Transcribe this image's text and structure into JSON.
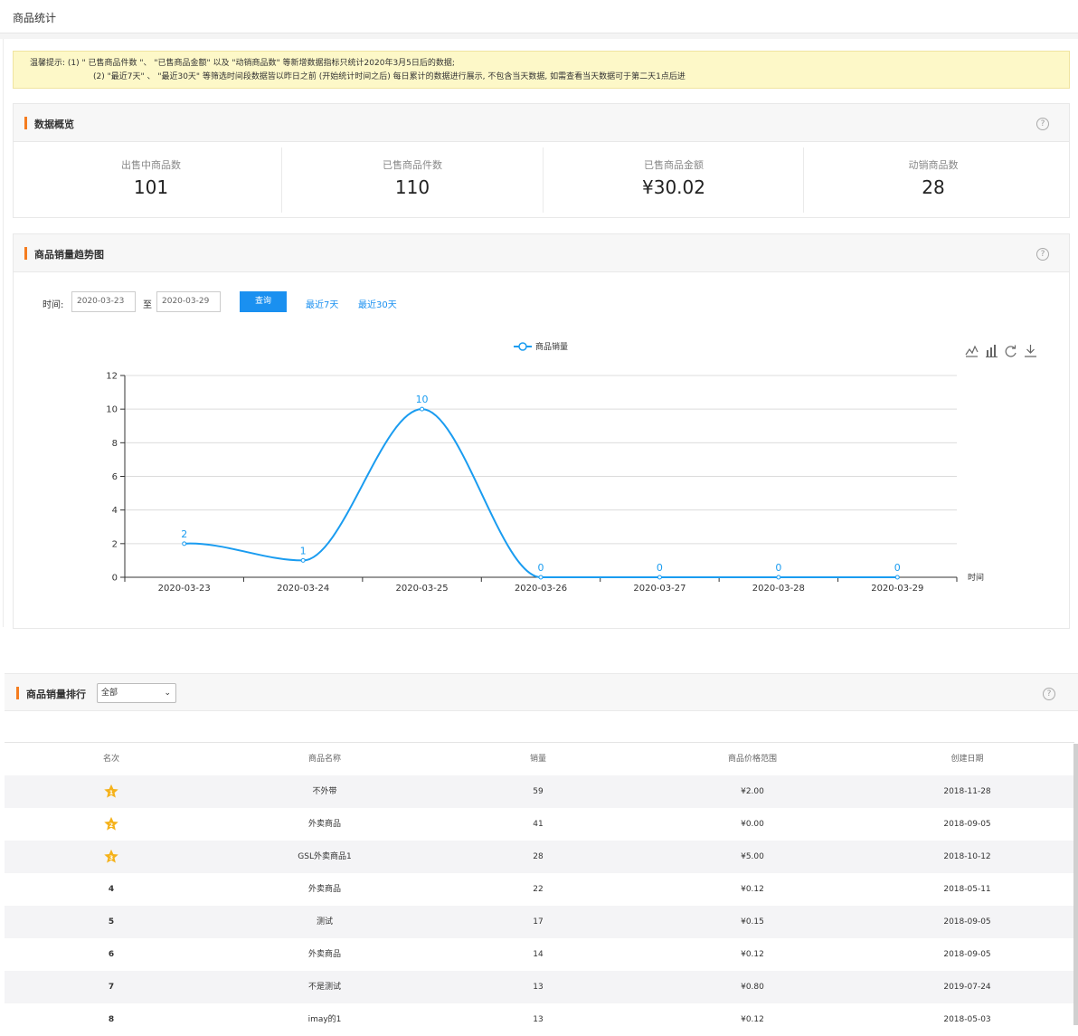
{
  "page": {
    "title": "商品统计"
  },
  "tips": {
    "prefix": "温馨提示:",
    "line1": "(1) \" 已售商品件数 \"、 \"已售商品金额\" 以及 \"动销商品数\" 等新增数据指标只统计2020年3月5日后的数据;",
    "line2": "(2) \"最近7天\" 、 \"最近30天\" 等筛选时间段数据皆以昨日之前 (开始统计时间之后) 每日累计的数据进行展示, 不包含当天数据, 如需查看当天数据可于第二天1点后进"
  },
  "overview": {
    "title": "数据概览",
    "help": "?",
    "stats": [
      {
        "label": "出售中商品数",
        "value": "101"
      },
      {
        "label": "已售商品件数",
        "value": "110"
      },
      {
        "label": "已售商品金额",
        "value": "¥30.02"
      },
      {
        "label": "动销商品数",
        "value": "28"
      }
    ]
  },
  "trend": {
    "title": "商品销量趋势图",
    "help": "?",
    "time_label": "时间:",
    "start_date": "2020-03-23",
    "to": "至",
    "end_date": "2020-03-29",
    "query": "查询",
    "last7": "最近7天",
    "last30": "最近30天",
    "toolbox": [
      "line-chart-icon",
      "bar-chart-icon",
      "refresh-icon",
      "download-icon"
    ]
  },
  "chart_data": {
    "type": "line",
    "categories": [
      "2020-03-23",
      "2020-03-24",
      "2020-03-25",
      "2020-03-26",
      "2020-03-27",
      "2020-03-28",
      "2020-03-29"
    ],
    "series": [
      {
        "name": "商品销量",
        "values": [
          2,
          1,
          10,
          0,
          0,
          0,
          0
        ]
      }
    ],
    "xlabel": "时间",
    "ylabel": "",
    "ylim": [
      0,
      12
    ],
    "yticks": [
      0,
      2,
      4,
      6,
      8,
      10,
      12
    ],
    "smooth": true,
    "grid": true,
    "legend": "top-center",
    "color": "#1a9cf0"
  },
  "ranking": {
    "title": "商品销量排行",
    "filter": "全部",
    "help": "?",
    "columns": [
      "名次",
      "商品名称",
      "销量",
      "商品价格范围",
      "创建日期"
    ],
    "rows": [
      {
        "rank": "1",
        "name": "不外带",
        "sales": "59",
        "price": "¥2.00",
        "date": "2018-11-28"
      },
      {
        "rank": "2",
        "name": "外卖商品",
        "sales": "41",
        "price": "¥0.00",
        "date": "2018-09-05"
      },
      {
        "rank": "3",
        "name": "GSL外卖商品1",
        "sales": "28",
        "price": "¥5.00",
        "date": "2018-10-12"
      },
      {
        "rank": "4",
        "name": "外卖商品",
        "sales": "22",
        "price": "¥0.12",
        "date": "2018-05-11"
      },
      {
        "rank": "5",
        "name": "测试",
        "sales": "17",
        "price": "¥0.15",
        "date": "2018-09-05"
      },
      {
        "rank": "6",
        "name": "外卖商品",
        "sales": "14",
        "price": "¥0.12",
        "date": "2018-09-05"
      },
      {
        "rank": "7",
        "name": "不是测试",
        "sales": "13",
        "price": "¥0.80",
        "date": "2019-07-24"
      },
      {
        "rank": "8",
        "name": "imay的1",
        "sales": "13",
        "price": "¥0.12",
        "date": "2018-05-03"
      }
    ],
    "medal_color": "#f5b21b"
  }
}
